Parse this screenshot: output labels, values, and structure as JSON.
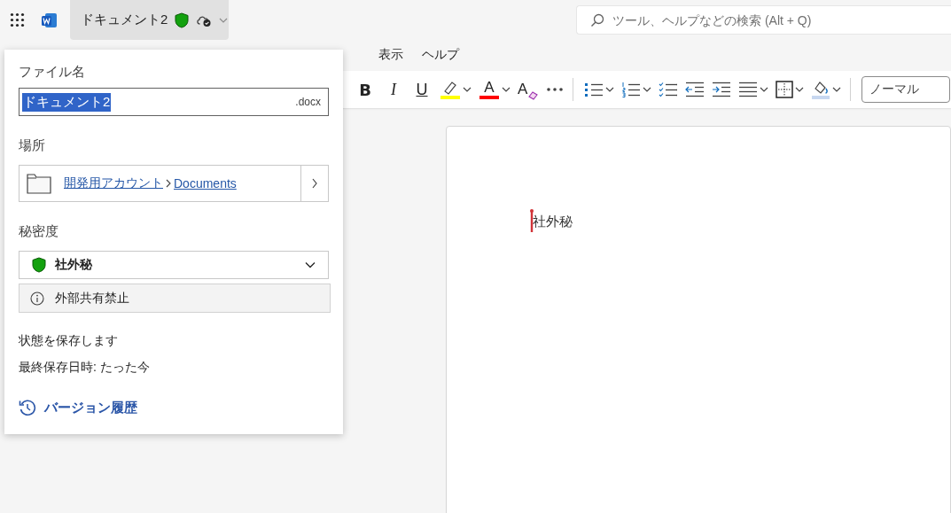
{
  "title_bar": {
    "document_title": "ドキュメント2",
    "search": {
      "placeholder": "ツール、ヘルプなどの検索 (Alt + Q)"
    }
  },
  "menu": [
    {
      "label": "表示"
    },
    {
      "label": "ヘルプ"
    }
  ],
  "toolbar": {
    "buttons": [
      {
        "kind": "bold",
        "label": "B"
      },
      {
        "kind": "italic",
        "label": "I"
      },
      {
        "kind": "underline",
        "label": "U"
      },
      {
        "kind": "highlight",
        "color": "#ffff00"
      },
      {
        "kind": "font_color",
        "label": "A",
        "color": "#ff0000"
      },
      {
        "kind": "clear_format",
        "label": "A"
      },
      {
        "kind": "more"
      },
      {
        "kind": "divider"
      },
      {
        "kind": "bullets"
      },
      {
        "kind": "numbering"
      },
      {
        "kind": "checklist"
      },
      {
        "kind": "outdent"
      },
      {
        "kind": "indent"
      },
      {
        "kind": "align"
      },
      {
        "kind": "borders"
      },
      {
        "kind": "shading"
      },
      {
        "kind": "divider"
      }
    ],
    "style_box": {
      "value": "ノーマル"
    }
  },
  "file_panel": {
    "file_name": {
      "label": "ファイル名",
      "value": "ドキュメント2",
      "extension": ".docx",
      "selected": true
    },
    "location": {
      "label": "場所",
      "account": "開発用アカウント",
      "folder": "Documents"
    },
    "sensitivity": {
      "label": "秘密度",
      "value": "社外秘",
      "description": "外部共有禁止"
    },
    "status": "状態を保存します",
    "last_saved": "最終保存日時: たった今",
    "version_history": "バージョン履歴"
  },
  "document": {
    "text": "社外秘"
  }
}
